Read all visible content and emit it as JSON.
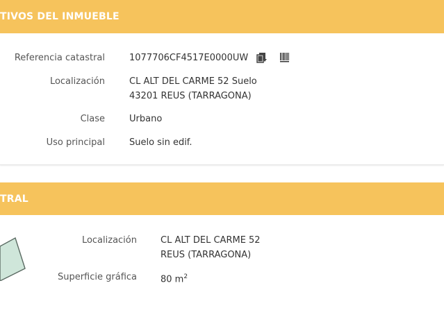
{
  "section1": {
    "header": "TIVOS DEL INMUEBLE",
    "fields": {
      "referencia": {
        "label": "Referencia catastral",
        "value": "1077706CF4517E0000UW"
      },
      "localizacion": {
        "label": "Localización",
        "line1": "CL ALT DEL CARME 52 Suelo",
        "line2": "43201 REUS (TARRAGONA)"
      },
      "clase": {
        "label": "Clase",
        "value": "Urbano"
      },
      "uso": {
        "label": "Uso principal",
        "value": "Suelo sin edif."
      }
    },
    "icons": [
      "copy-icon",
      "barcode-icon"
    ]
  },
  "section2": {
    "header": "TRAL",
    "fields": {
      "localizacion": {
        "label": "Localización",
        "line1": "CL ALT DEL CARME 52",
        "line2": "REUS (TARRAGONA)"
      },
      "superficie": {
        "label": "Superficie gráfica",
        "value": "80 m",
        "unit_sup": "2"
      }
    }
  },
  "colors": {
    "header_bg": "#f6c35c",
    "parcel_fill": "#cfe6da",
    "parcel_stroke": "#5a6a62"
  }
}
